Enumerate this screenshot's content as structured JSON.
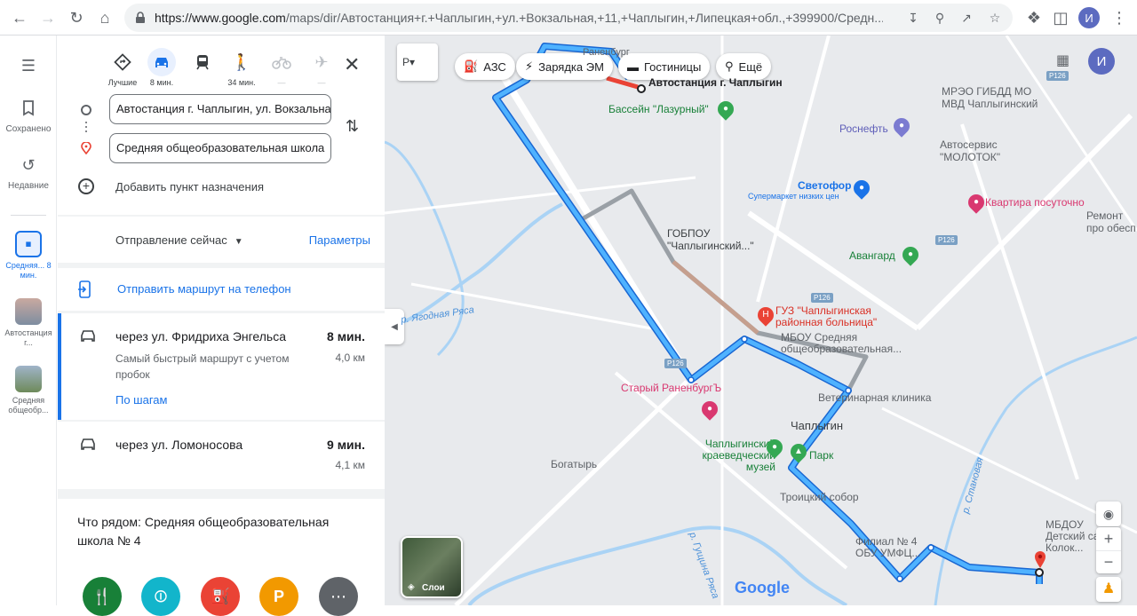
{
  "browser": {
    "url_main": "https://www.google.com",
    "url_rest": "/maps/dir/Автостанция+г.+Чаплыгин,+ул.+Вокзальная,+11,+Чаплыгин,+Липецкая+обл.,+399900/Средн...",
    "profile_initial": "И"
  },
  "rail": {
    "saved_label": "Сохранено",
    "recent_label": "Недавние",
    "history": [
      {
        "label": "Средняя... 8 мин."
      },
      {
        "label": "Автостанция г..."
      },
      {
        "label": "Средняя общеобр..."
      }
    ]
  },
  "modes": [
    {
      "label": "Лучшие",
      "icon": "diamond-route-icon"
    },
    {
      "label": "8 мин.",
      "icon": "car-icon"
    },
    {
      "label": "",
      "icon": "train-icon"
    },
    {
      "label": "34 мин.",
      "icon": "walk-icon"
    },
    {
      "label": "—",
      "icon": "bicycle-icon"
    },
    {
      "label": "—",
      "icon": "plane-icon"
    }
  ],
  "directions": {
    "origin": "Автостанция г. Чаплыгин, ул. Вокзальная",
    "destination": "Средняя общеобразовательная школа",
    "add_destination": "Добавить пункт назначения",
    "depart_label": "Отправление сейчас",
    "params_label": "Параметры",
    "send_label": "Отправить маршрут на телефон"
  },
  "routes": [
    {
      "title": "через ул. Фридриха Энгельса",
      "time": "8 мин.",
      "distance": "4,0 км",
      "desc": "Самый быстрый маршрут с учетом пробок",
      "steps": "По шагам"
    },
    {
      "title": "через ул. Ломоносова",
      "time": "9 мин.",
      "distance": "4,1 км"
    }
  ],
  "nearby": {
    "title": "Что рядом: Средняя общеобразовательная школа № 4"
  },
  "map_chips": [
    {
      "label": "АЗС"
    },
    {
      "label": "Зарядка ЭМ"
    },
    {
      "label": "Гостиницы"
    },
    {
      "label": "Ещё"
    }
  ],
  "map_labels": {
    "busstation": "Автостанция г. Чаплыгин",
    "pool": "Бассейн \"Лазурный\"",
    "ranenburg": "Раненбург",
    "mreo": "МРЭО ГИБДД МО МВД Чаплыгинский",
    "rosneft": "Роснефть",
    "autoservice": "Автосервис \"МОЛОТОК\"",
    "svetofor": "Светофор",
    "svetofor_sub": "Супермаркет низких цен",
    "kvartira": "Квартира посуточно",
    "remont": "Ремонт про обесп",
    "gobpou": "ГОБПОУ \"Чаплыгинский...\"",
    "avangard": "Авангард",
    "hospital": "ГУЗ \"Чаплыгинская районная больница\"",
    "mbou": "МБОУ Средняя общеобразовательная...",
    "vet": "Ветеринарная клиника",
    "stary": "Старый РаненбургЪ",
    "chaplygin": "Чаплыгин",
    "museum": "Чаплыгинский краеведческий музей",
    "park": "Парк",
    "bogatyr": "Богатырь",
    "troitsky": "Троицкий собор",
    "filial": "Филиал № 4 ОБУ УМФЦ...",
    "mbdou": "МБДОУ Детский сад Колок...",
    "river1": "р. Ягодная Ряса",
    "river2": "р. Становая",
    "river3": "р. Гущина Ряса",
    "layers": "Слои",
    "google": "Google",
    "r126": "Р126"
  },
  "colors": {
    "accent": "#1a73e8",
    "route": "#1e88e5",
    "route_gray": "#9aa0a6",
    "dest_pin": "#ea4335"
  }
}
